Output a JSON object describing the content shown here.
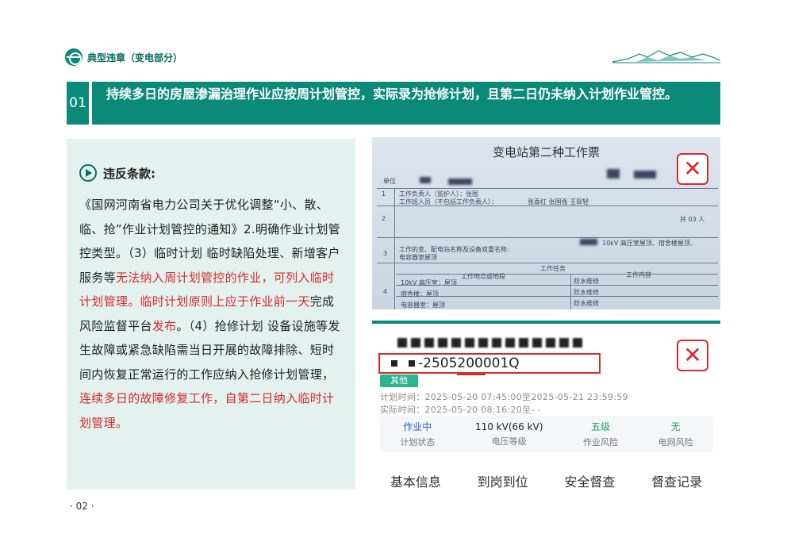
{
  "header": {
    "brand_title": "典型违章（变电部分）"
  },
  "title_bar": {
    "number": "01",
    "text": "持续多日的房屋渗漏治理作业应按周计划管控，实际录为抢修计划，且第二日仍未纳入计划作业管控。"
  },
  "left_panel": {
    "section_title": "违反条款:",
    "segments": [
      {
        "text": "《国网河南省电力公司关于优化调整“小、散、临、抢”作业计划管控的通知》2.明确作业计划管控类型。（3）临时计划 临时缺陷处理、新增客户服务等",
        "color": "normal"
      },
      {
        "text": "无法纳入周计划管控的作业，可列入临时计划管理。临时计划原则上应于作业前一天",
        "color": "red"
      },
      {
        "text": "完成风险监督平台",
        "color": "normal"
      },
      {
        "text": "发布",
        "color": "red"
      },
      {
        "text": "。（4）抢修计划 设备设施等发生故障或紧急缺陷需当日开展的故障排除、短时间内恢复正常运行的工作应纳入抢修计划管理，",
        "color": "normal"
      },
      {
        "text": "连续多日的故障修复工作，自第二日纳入临时计划管理。",
        "color": "red"
      }
    ]
  },
  "ticket_photo": {
    "title": "变电站第二种工作票",
    "unit_label": "单位",
    "row1_label": "工作负责人（监护人）：张图",
    "row1b_label": "工作班人员（不包括工作负责人）：",
    "row1b_names": "张喜红  张国强  王现轻",
    "total_label": "共 03 人",
    "row3_label": "工作的变、配电站名称及设备双重名称:",
    "row3_label_b": "电容器室屋顶",
    "row3_value": "10kV 高压室屋顶、宿舍楼屋顶、",
    "task_header": "工作任务",
    "col_location": "工作地点或地段",
    "col_content": "工作内容",
    "rows": [
      {
        "location": "10kV 高压室：屋顶",
        "content": "防水维修"
      },
      {
        "location": "宿舍楼：屋顶",
        "content": "防水维修"
      },
      {
        "location": "电容器室：屋顶",
        "content": "防水维修"
      }
    ],
    "row_numbers": [
      "1",
      "2",
      "3",
      "4"
    ],
    "x_icon": "close-icon"
  },
  "app_screen": {
    "code": "-2505200001Q",
    "tag": "其他",
    "plan_time_label": "计划时间：",
    "plan_time": "2025-05-20 07:45:00至2025-05-21 23:59:59",
    "actual_time_label": "实际时间：",
    "actual_time": "2025-05-20 08:16:20至- -",
    "stats": [
      {
        "value": "作业中",
        "label": "计划状态",
        "color": "blue"
      },
      {
        "value": "110 kV(66 kV)",
        "label": "电压等级",
        "color": "normal"
      },
      {
        "value": "五级",
        "label": "作业风险",
        "color": "green"
      },
      {
        "value": "无",
        "label": "电网风险",
        "color": "green"
      }
    ],
    "tabs": [
      "基本信息",
      "到岗到位",
      "安全督查",
      "督查记录"
    ],
    "x_icon": "close-icon"
  },
  "page_number": "· 02 ·",
  "colors": {
    "primary": "#0b8a7a",
    "panel_bg": "#e4f2ef",
    "highlight": "#d62b2b"
  }
}
